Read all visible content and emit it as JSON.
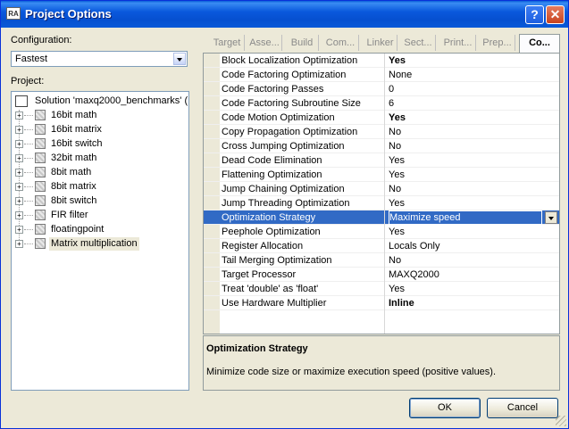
{
  "window": {
    "title": "Project Options",
    "app_icon_text": "RA"
  },
  "configuration": {
    "label": "Configuration:",
    "value": "Fastest"
  },
  "project": {
    "label": "Project:",
    "solution": "Solution 'maxq2000_benchmarks' (...",
    "items": [
      "16bit math",
      "16bit matrix",
      "16bit switch",
      "32bit math",
      "8bit math",
      "8bit matrix",
      "8bit switch",
      "FIR filter",
      "floatingpoint",
      "Matrix multiplication"
    ]
  },
  "tabs": [
    "Target",
    "Asse...",
    "Build",
    "Com...",
    "Linker",
    "Sect...",
    "Print...",
    "Prep...",
    "Co..."
  ],
  "properties": [
    {
      "name": "Block Localization Optimization",
      "value": "Yes",
      "bold": true
    },
    {
      "name": "Code Factoring Optimization",
      "value": "None"
    },
    {
      "name": "Code Factoring Passes",
      "value": "0"
    },
    {
      "name": "Code Factoring Subroutine Size",
      "value": "6"
    },
    {
      "name": "Code Motion Optimization",
      "value": "Yes",
      "bold": true
    },
    {
      "name": "Copy Propagation Optimization",
      "value": "No"
    },
    {
      "name": "Cross Jumping Optimization",
      "value": "No"
    },
    {
      "name": "Dead Code Elimination",
      "value": "Yes"
    },
    {
      "name": "Flattening Optimization",
      "value": "Yes"
    },
    {
      "name": "Jump Chaining Optimization",
      "value": "No"
    },
    {
      "name": "Jump Threading Optimization",
      "value": "Yes"
    },
    {
      "name": "Optimization Strategy",
      "value": "Maximize speed",
      "selected": true
    },
    {
      "name": "Peephole Optimization",
      "value": "Yes"
    },
    {
      "name": "Register Allocation",
      "value": "Locals Only"
    },
    {
      "name": "Tail Merging Optimization",
      "value": "No"
    },
    {
      "name": "Target Processor",
      "value": "MAXQ2000"
    },
    {
      "name": "Treat 'double' as 'float'",
      "value": "Yes"
    },
    {
      "name": "Use Hardware Multiplier",
      "value": "Inline",
      "bold": true
    }
  ],
  "description": {
    "title": "Optimization Strategy",
    "text": "Minimize code size or maximize execution speed (positive values)."
  },
  "buttons": {
    "ok": "OK",
    "cancel": "Cancel"
  }
}
